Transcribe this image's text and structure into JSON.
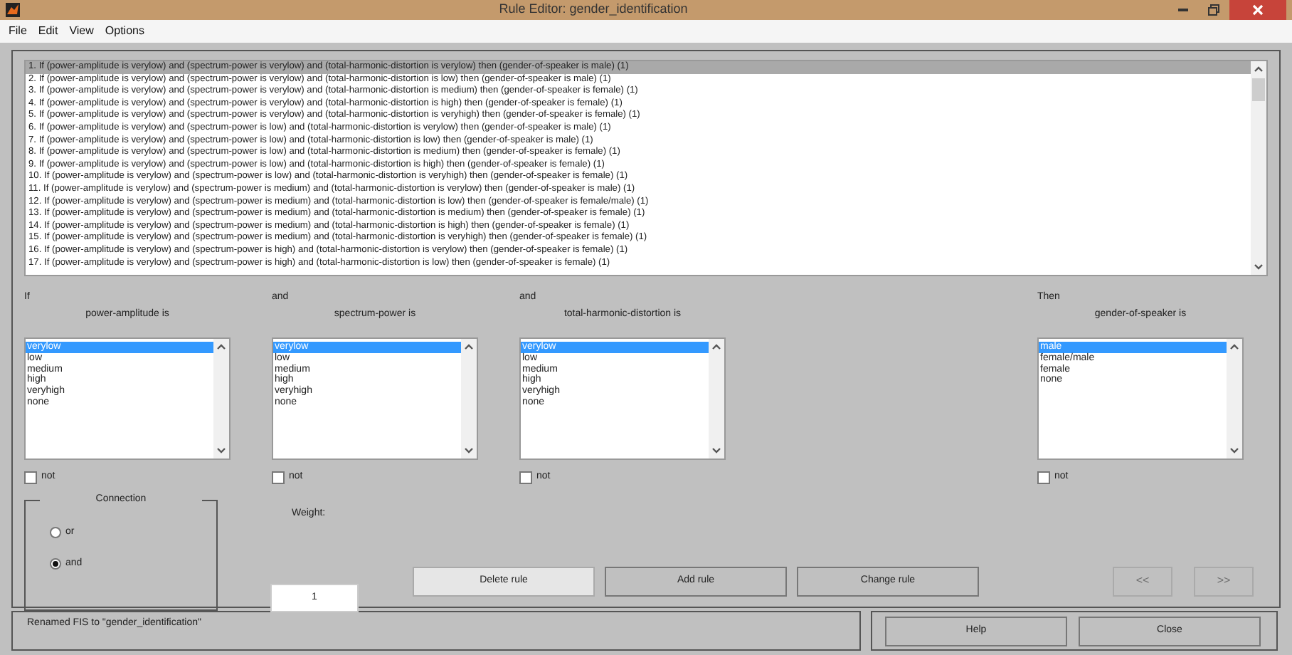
{
  "window": {
    "title": "Rule Editor: gender_identification"
  },
  "menu": [
    "File",
    "Edit",
    "View",
    "Options"
  ],
  "rules": [
    {
      "text": "1. If (power-amplitude is verylow) and (spectrum-power is verylow) and (total-harmonic-distortion is verylow) then (gender-of-speaker is male) (1)",
      "selected": true
    },
    {
      "text": "2. If (power-amplitude is verylow) and (spectrum-power is verylow) and (total-harmonic-distortion is low) then (gender-of-speaker is male) (1)",
      "selected": false
    },
    {
      "text": "3. If (power-amplitude is verylow) and (spectrum-power is verylow) and (total-harmonic-distortion is medium) then (gender-of-speaker is female) (1)",
      "selected": false
    },
    {
      "text": "4. If (power-amplitude is verylow) and (spectrum-power is verylow) and (total-harmonic-distortion is high) then (gender-of-speaker is female) (1)",
      "selected": false
    },
    {
      "text": "5. If (power-amplitude is verylow) and (spectrum-power is verylow) and (total-harmonic-distortion is veryhigh) then (gender-of-speaker is female) (1)",
      "selected": false
    },
    {
      "text": "6. If (power-amplitude is verylow) and (spectrum-power is low) and (total-harmonic-distortion is verylow) then (gender-of-speaker is male) (1)",
      "selected": false
    },
    {
      "text": "7. If (power-amplitude is verylow) and (spectrum-power is low) and (total-harmonic-distortion is low) then (gender-of-speaker is male) (1)",
      "selected": false
    },
    {
      "text": "8. If (power-amplitude is verylow) and (spectrum-power is low) and (total-harmonic-distortion is medium) then (gender-of-speaker is female) (1)",
      "selected": false
    },
    {
      "text": "9. If (power-amplitude is verylow) and (spectrum-power is low) and (total-harmonic-distortion is high) then (gender-of-speaker is female) (1)",
      "selected": false
    },
    {
      "text": "10. If (power-amplitude is verylow) and (spectrum-power is low) and (total-harmonic-distortion is veryhigh) then (gender-of-speaker is female) (1)",
      "selected": false
    },
    {
      "text": "11. If (power-amplitude is verylow) and (spectrum-power is medium) and (total-harmonic-distortion is verylow) then (gender-of-speaker is male) (1)",
      "selected": false
    },
    {
      "text": "12. If (power-amplitude is verylow) and (spectrum-power is medium) and (total-harmonic-distortion is low) then (gender-of-speaker is female/male) (1)",
      "selected": false
    },
    {
      "text": "13. If (power-amplitude is verylow) and (spectrum-power is medium) and (total-harmonic-distortion is medium) then (gender-of-speaker is female) (1)",
      "selected": false
    },
    {
      "text": "14. If (power-amplitude is verylow) and (spectrum-power is medium) and (total-harmonic-distortion is high) then (gender-of-speaker is female) (1)",
      "selected": false
    },
    {
      "text": "15. If (power-amplitude is verylow) and (spectrum-power is medium) and (total-harmonic-distortion is veryhigh) then (gender-of-speaker is female) (1)",
      "selected": false
    },
    {
      "text": "16. If (power-amplitude is verylow) and (spectrum-power is high) and (total-harmonic-distortion is verylow) then (gender-of-speaker is female) (1)",
      "selected": false
    },
    {
      "text": "17. If (power-amplitude is verylow) and (spectrum-power is high) and (total-harmonic-distortion is low) then (gender-of-speaker is female) (1)",
      "selected": false
    }
  ],
  "inputs": [
    {
      "prefix": "If",
      "label": "power-amplitude is",
      "not": false,
      "options": [
        {
          "text": "verylow",
          "selected": true
        },
        {
          "text": "low",
          "selected": false
        },
        {
          "text": "medium",
          "selected": false
        },
        {
          "text": "high",
          "selected": false
        },
        {
          "text": "veryhigh",
          "selected": false
        },
        {
          "text": "none",
          "selected": false
        }
      ],
      "not_label": "not"
    },
    {
      "prefix": "and",
      "label": "spectrum-power is",
      "not": false,
      "options": [
        {
          "text": "verylow",
          "selected": true
        },
        {
          "text": "low",
          "selected": false
        },
        {
          "text": "medium",
          "selected": false
        },
        {
          "text": "high",
          "selected": false
        },
        {
          "text": "veryhigh",
          "selected": false
        },
        {
          "text": "none",
          "selected": false
        }
      ],
      "not_label": "not"
    },
    {
      "prefix": "and",
      "label": "total-harmonic-distortion is",
      "not": false,
      "options": [
        {
          "text": "verylow",
          "selected": true
        },
        {
          "text": "low",
          "selected": false
        },
        {
          "text": "medium",
          "selected": false
        },
        {
          "text": "high",
          "selected": false
        },
        {
          "text": "veryhigh",
          "selected": false
        },
        {
          "text": "none",
          "selected": false
        }
      ],
      "not_label": "not"
    }
  ],
  "output": {
    "prefix": "Then",
    "label": "gender-of-speaker is",
    "not": false,
    "options": [
      {
        "text": "male",
        "selected": true
      },
      {
        "text": "female/male",
        "selected": false
      },
      {
        "text": "female",
        "selected": false
      },
      {
        "text": "none",
        "selected": false
      }
    ],
    "not_label": "not"
  },
  "connection": {
    "title": "Connection",
    "options": [
      {
        "text": "or",
        "selected": false
      },
      {
        "text": "and",
        "selected": true
      }
    ]
  },
  "weight": {
    "label": "Weight:",
    "value": "1"
  },
  "buttons": [
    {
      "label": "Delete rule",
      "focused": true
    },
    {
      "label": "Add rule",
      "focused": false
    },
    {
      "label": "Change rule",
      "focused": false
    }
  ],
  "nav": [
    {
      "label": "<<",
      "disabled": true
    },
    {
      "label": ">>",
      "disabled": true
    }
  ],
  "status": "Renamed FIS to \"gender_identification\"",
  "footer_buttons": [
    "Help",
    "Close"
  ]
}
